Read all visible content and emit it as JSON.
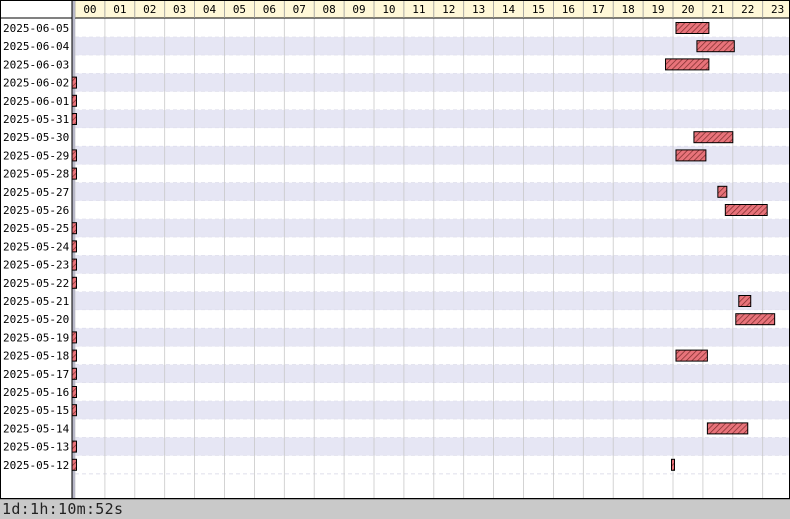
{
  "status_text": "1d:1h:10m:52s",
  "chart_data": {
    "type": "gantt",
    "x_unit": "hour of day",
    "xlim": [
      0,
      24
    ],
    "hour_labels": [
      "00",
      "01",
      "02",
      "03",
      "04",
      "05",
      "06",
      "07",
      "08",
      "09",
      "10",
      "11",
      "12",
      "13",
      "14",
      "15",
      "16",
      "17",
      "18",
      "19",
      "20",
      "21",
      "22",
      "23"
    ],
    "grid": true,
    "colors": {
      "bar_fill": "#e8737a",
      "bar_hatch": "#7a2a2a",
      "bar_border": "#000000",
      "row_even": "#ffffff",
      "row_odd": "#e6e6f4",
      "hour_header_bg": "#fff8d8",
      "grid_line": "#c8c8c8"
    },
    "rows": [
      {
        "date": "2025-06-05",
        "intervals": [
          [
            20.1,
            21.2
          ]
        ]
      },
      {
        "date": "2025-06-04",
        "intervals": [
          [
            20.8,
            22.05
          ]
        ]
      },
      {
        "date": "2025-06-03",
        "intervals": [
          [
            19.75,
            21.2
          ]
        ]
      },
      {
        "date": "2025-06-02",
        "intervals": [
          [
            -0.1,
            0.05
          ]
        ]
      },
      {
        "date": "2025-06-01",
        "intervals": [
          [
            -0.1,
            0.05
          ]
        ]
      },
      {
        "date": "2025-05-31",
        "intervals": [
          [
            -0.1,
            0.05
          ]
        ]
      },
      {
        "date": "2025-05-30",
        "intervals": [
          [
            20.7,
            22.0
          ]
        ]
      },
      {
        "date": "2025-05-29",
        "intervals": [
          [
            -0.1,
            0.05
          ],
          [
            20.1,
            21.1
          ]
        ]
      },
      {
        "date": "2025-05-28",
        "intervals": [
          [
            -0.1,
            0.05
          ]
        ]
      },
      {
        "date": "2025-05-27",
        "intervals": [
          [
            21.5,
            21.8
          ]
        ]
      },
      {
        "date": "2025-05-26",
        "intervals": [
          [
            21.75,
            23.15
          ]
        ]
      },
      {
        "date": "2025-05-25",
        "intervals": [
          [
            -0.1,
            0.05
          ]
        ]
      },
      {
        "date": "2025-05-24",
        "intervals": [
          [
            -0.1,
            0.05
          ]
        ]
      },
      {
        "date": "2025-05-23",
        "intervals": [
          [
            -0.1,
            0.05
          ]
        ]
      },
      {
        "date": "2025-05-22",
        "intervals": [
          [
            -0.1,
            0.05
          ]
        ]
      },
      {
        "date": "2025-05-21",
        "intervals": [
          [
            22.2,
            22.6
          ]
        ]
      },
      {
        "date": "2025-05-20",
        "intervals": [
          [
            22.1,
            23.4
          ]
        ]
      },
      {
        "date": "2025-05-19",
        "intervals": [
          [
            -0.1,
            0.05
          ]
        ]
      },
      {
        "date": "2025-05-18",
        "intervals": [
          [
            -0.1,
            0.05
          ],
          [
            20.1,
            21.15
          ]
        ]
      },
      {
        "date": "2025-05-17",
        "intervals": [
          [
            -0.1,
            0.05
          ]
        ]
      },
      {
        "date": "2025-05-16",
        "intervals": [
          [
            -0.1,
            0.05
          ]
        ]
      },
      {
        "date": "2025-05-15",
        "intervals": [
          [
            -0.1,
            0.05
          ]
        ]
      },
      {
        "date": "2025-05-14",
        "intervals": [
          [
            21.15,
            22.5
          ]
        ]
      },
      {
        "date": "2025-05-13",
        "intervals": [
          [
            -0.1,
            0.05
          ]
        ]
      },
      {
        "date": "2025-05-12",
        "intervals": [
          [
            -0.1,
            0.05
          ],
          [
            19.95,
            20.05
          ]
        ]
      }
    ]
  }
}
